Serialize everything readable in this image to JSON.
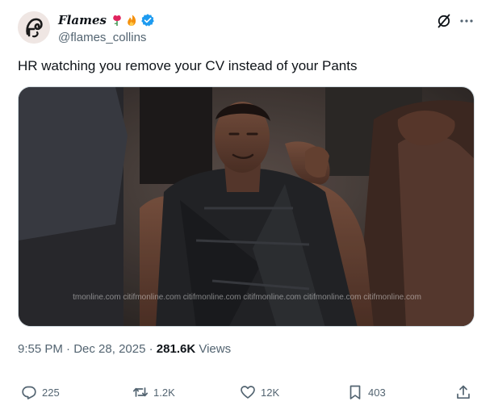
{
  "author": {
    "display_name": "Flames",
    "handle": "@flames_collins",
    "name_emojis": [
      "rose-icon",
      "fire-icon"
    ],
    "verified": true,
    "verified_color": "#1d9bf0"
  },
  "header": {
    "icons": [
      "grok-icon",
      "more-icon"
    ]
  },
  "post": {
    "text": "HR watching you remove your CV instead of your Pants",
    "media_watermark": "tmonline.com citifmonline.com citifmonline.com citifmonline.com citifmonline.com citifmonline.com"
  },
  "meta": {
    "time": "9:55 PM",
    "separator1": "·",
    "date": "Dec 28, 2025",
    "separator2": "·",
    "views_count": "281.6K",
    "views_label": "Views"
  },
  "actions": {
    "replies": "225",
    "reposts": "1.2K",
    "likes": "12K",
    "bookmarks": "403"
  },
  "colors": {
    "text_primary": "#0f1419",
    "text_secondary": "#536471",
    "accent": "#1d9bf0"
  }
}
